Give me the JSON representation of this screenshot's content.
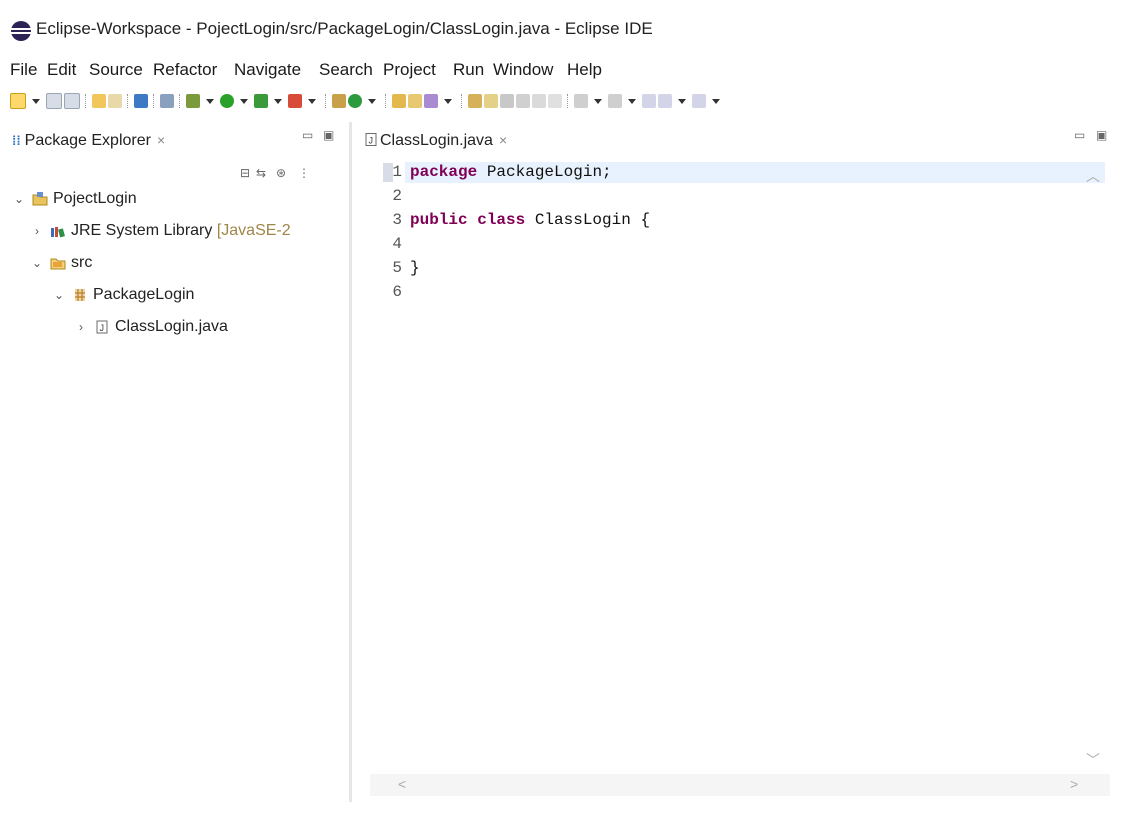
{
  "window": {
    "title": "Eclipse-Workspace - PojectLogin/src/PackageLogin/ClassLogin.java - Eclipse IDE",
    "app_icon": "eclipse-icon"
  },
  "menu": {
    "items": [
      "File",
      "Edit",
      "Source",
      "Refactor",
      "Navigate",
      "Search",
      "Project",
      "Run",
      "Window",
      "Help"
    ]
  },
  "package_explorer": {
    "tab_label": "Package Explorer",
    "tab_close": "×",
    "tree": {
      "project": "PojectLogin",
      "jre_label": "JRE System Library",
      "jre_suffix": "[JavaSE-2",
      "src": "src",
      "package": "PackageLogin",
      "file": "ClassLogin.java"
    }
  },
  "editor": {
    "tab_label": "ClassLogin.java",
    "tab_close": "×",
    "line_numbers": [
      "1",
      "2",
      "3",
      "4",
      "5",
      "6"
    ],
    "lines": [
      {
        "kw": "package",
        "rest": " PackageLogin;"
      },
      {
        "kw": "",
        "rest": ""
      },
      {
        "kw": "public class",
        "rest": " ClassLogin {"
      },
      {
        "kw": "",
        "rest": ""
      },
      {
        "kw": "",
        "rest": "}"
      },
      {
        "kw": "",
        "rest": ""
      }
    ]
  },
  "colors": {
    "keyword": "#7f0055",
    "current_line": "#e8f2fe",
    "eclipse_purple": "#2c2255"
  }
}
